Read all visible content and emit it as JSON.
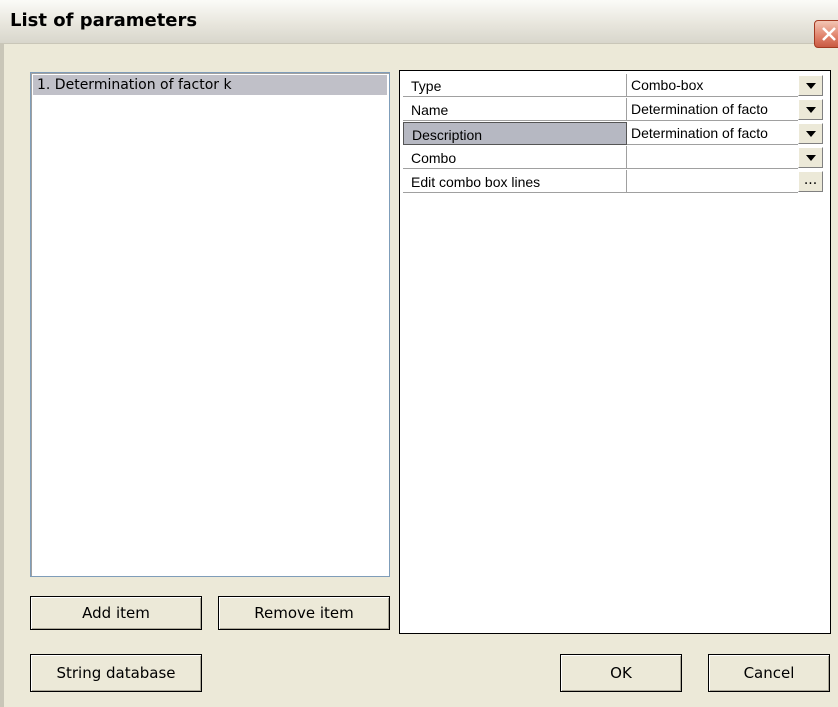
{
  "window": {
    "title": "List of parameters"
  },
  "list": {
    "items": [
      {
        "label": "1. Determination of factor k"
      }
    ]
  },
  "buttons": {
    "add_item": "Add item",
    "remove_item": "Remove item",
    "string_database": "String database",
    "ok": "OK",
    "cancel": "Cancel"
  },
  "properties": [
    {
      "name": "Type",
      "value": "Combo-box",
      "editor": "dropdown"
    },
    {
      "name": "Name",
      "value": "Determination of facto",
      "editor": "dropdown"
    },
    {
      "name": "Description",
      "value": "Determination of facto",
      "editor": "dropdown",
      "selected": true
    },
    {
      "name": "Combo",
      "value": "",
      "editor": "dropdown"
    },
    {
      "name": "Edit combo box lines",
      "value": "",
      "editor": "ellipsis",
      "button_label": "..."
    }
  ],
  "icons": {
    "close": "close-icon",
    "dropdown": "dropdown-arrow-icon"
  }
}
